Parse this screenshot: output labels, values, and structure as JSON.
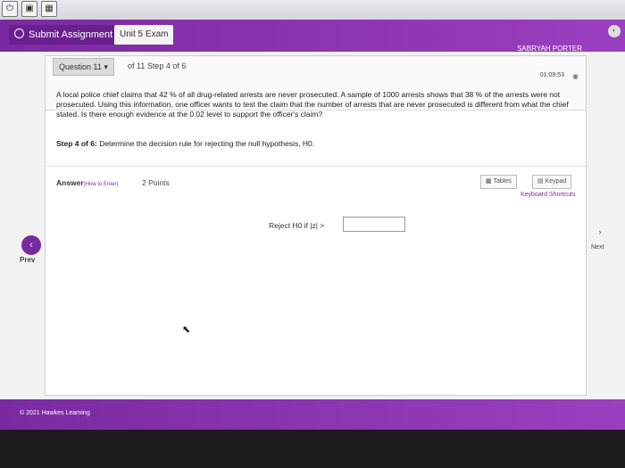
{
  "toolbar": {
    "submit_label": "Submit Assignment",
    "exam_tab": "Unit 5 Exam",
    "user": "SABRYAH PORTER"
  },
  "question": {
    "selector": "Question 11",
    "of_text": "of 11 Step 4 of 6",
    "timer": "01:09:53",
    "text": "A local police chief claims that 42 % of all drug-related arrests are never prosecuted. A sample of 1000 arrests shows that 38 % of the arrests were not prosecuted. Using this information, one officer wants to test the claim that the number of arrests that are never prosecuted is different from what the chief stated. Is there enough evidence at the 0.02 level to support the officer's claim?",
    "step_label": "Step 4 of 6:",
    "step_text": "Determine the decision rule for rejecting the null hypothesis, H0."
  },
  "answer": {
    "label": "Answer",
    "howto": "(How to Enter)",
    "points": "2 Points",
    "tables": "Tables",
    "keypad": "Keypad",
    "keyboard": "Keyboard Shortcuts",
    "reject_text": "Reject H0 if |z| >",
    "input_value": ""
  },
  "nav": {
    "prev": "Prev",
    "next": "Next"
  },
  "footer": {
    "copyright": "© 2021 Hawkes Learning"
  }
}
